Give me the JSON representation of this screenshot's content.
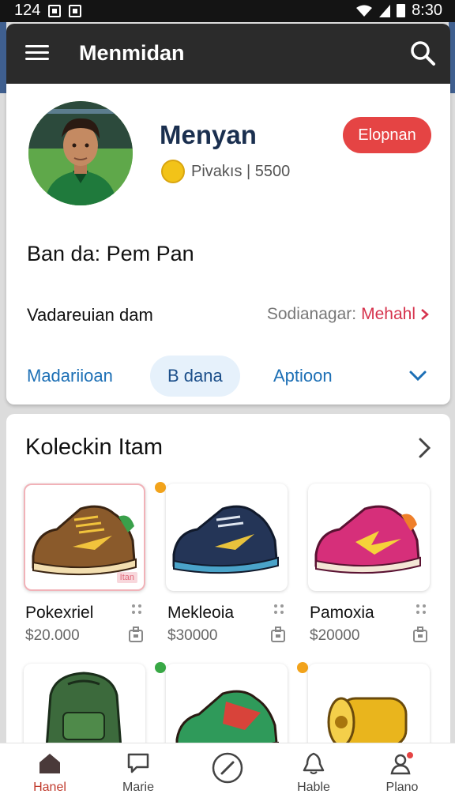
{
  "status": {
    "left_time": "124",
    "right_time": "8:30"
  },
  "appbar": {
    "title": "Menmidan"
  },
  "profile": {
    "name": "Menyan",
    "points": "Pivakıs | 5500",
    "follow_label": "Elopnan",
    "bio": "Ban da: Pem Pan",
    "detail_left": "Vadareuian dam",
    "detail_key": "Sodianagar:",
    "detail_value": "Mehahl"
  },
  "tabs": [
    {
      "label": "Madariioan"
    },
    {
      "label": "B dana",
      "active": true
    },
    {
      "label": "Aptioon"
    }
  ],
  "collection": {
    "title": "Koleckin Itam",
    "items": [
      {
        "name": "Pokexriel",
        "price": "$20.000",
        "tag": "Itan"
      },
      {
        "name": "Mekleoia",
        "price": "$30000"
      },
      {
        "name": "Pamoxia",
        "price": "$20000"
      },
      {
        "name": "",
        "price": ""
      },
      {
        "name": "",
        "price": ""
      },
      {
        "name": "",
        "price": ""
      }
    ]
  },
  "nav": [
    {
      "label": "Hanel",
      "icon": "home-icon",
      "active": true
    },
    {
      "label": "Marie",
      "icon": "chat-icon"
    },
    {
      "label": "",
      "icon": "compass-icon"
    },
    {
      "label": "Hable",
      "icon": "bell-icon"
    },
    {
      "label": "Plano",
      "icon": "profile-icon"
    }
  ],
  "colors": {
    "appbar": "#2b2b2b",
    "accent_red": "#e54444",
    "tab_blue": "#1c6fb5",
    "heading": "#1a2f4f"
  }
}
